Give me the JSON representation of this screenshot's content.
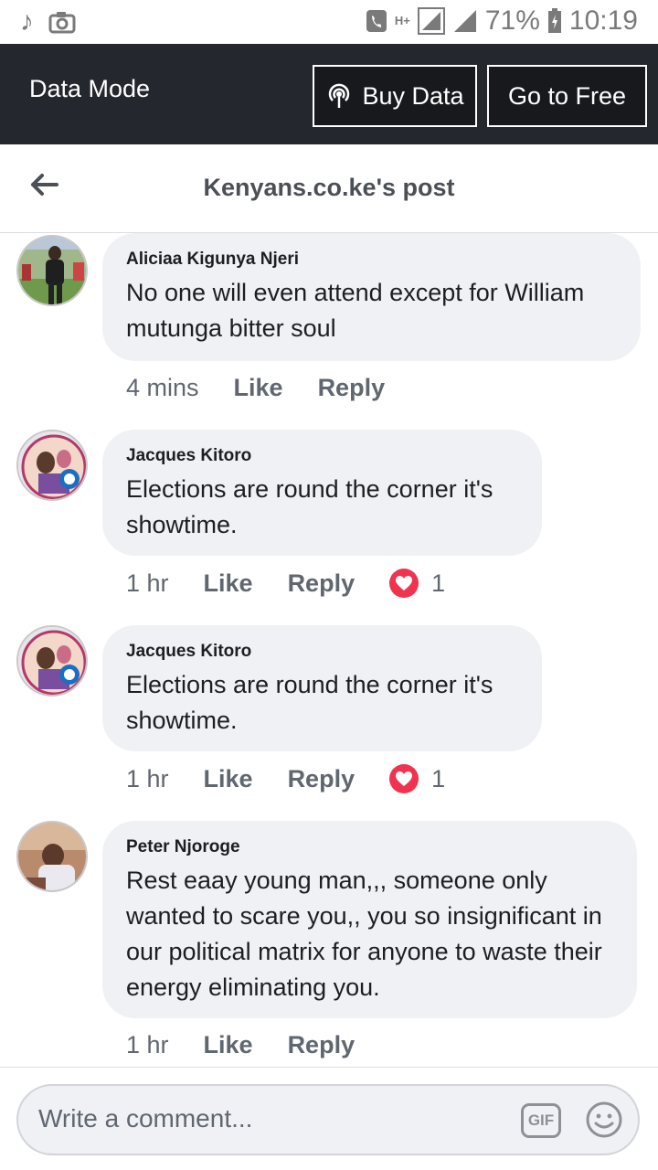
{
  "status_bar": {
    "network_type": "H+",
    "battery": "71%",
    "time": "10:19"
  },
  "data_bar": {
    "label": "Data Mode",
    "buy_label": "Buy Data",
    "free_label": "Go to Free"
  },
  "header": {
    "title": "Kenyans.co.ke's post"
  },
  "comments": [
    {
      "author": "Aliciaa Kigunya Njeri",
      "text": "No one will even attend except for William mutunga bitter soul",
      "time": "4 mins",
      "like": "Like",
      "reply": "Reply",
      "reactions": ""
    },
    {
      "author": "Jacques Kitoro",
      "text": "Elections are round the corner it's showtime.",
      "time": "1 hr",
      "like": "Like",
      "reply": "Reply",
      "reactions": "1"
    },
    {
      "author": "Jacques Kitoro",
      "text": "Elections are round the corner it's showtime.",
      "time": "1 hr",
      "like": "Like",
      "reply": "Reply",
      "reactions": "1"
    },
    {
      "author": "Peter Njoroge",
      "text": "Rest eaay young man,,, someone only wanted to scare you,, you so insignificant in our political matrix for anyone to waste their energy eliminating you.",
      "time": "1 hr",
      "like": "Like",
      "reply": "Reply",
      "reactions": ""
    }
  ],
  "composer": {
    "placeholder": "Write a comment...",
    "gif_label": "GIF"
  },
  "colors": {
    "data_bar_bg": "#24272d",
    "bubble_bg": "#f0f1f5",
    "love_reaction": "#f0334f"
  }
}
